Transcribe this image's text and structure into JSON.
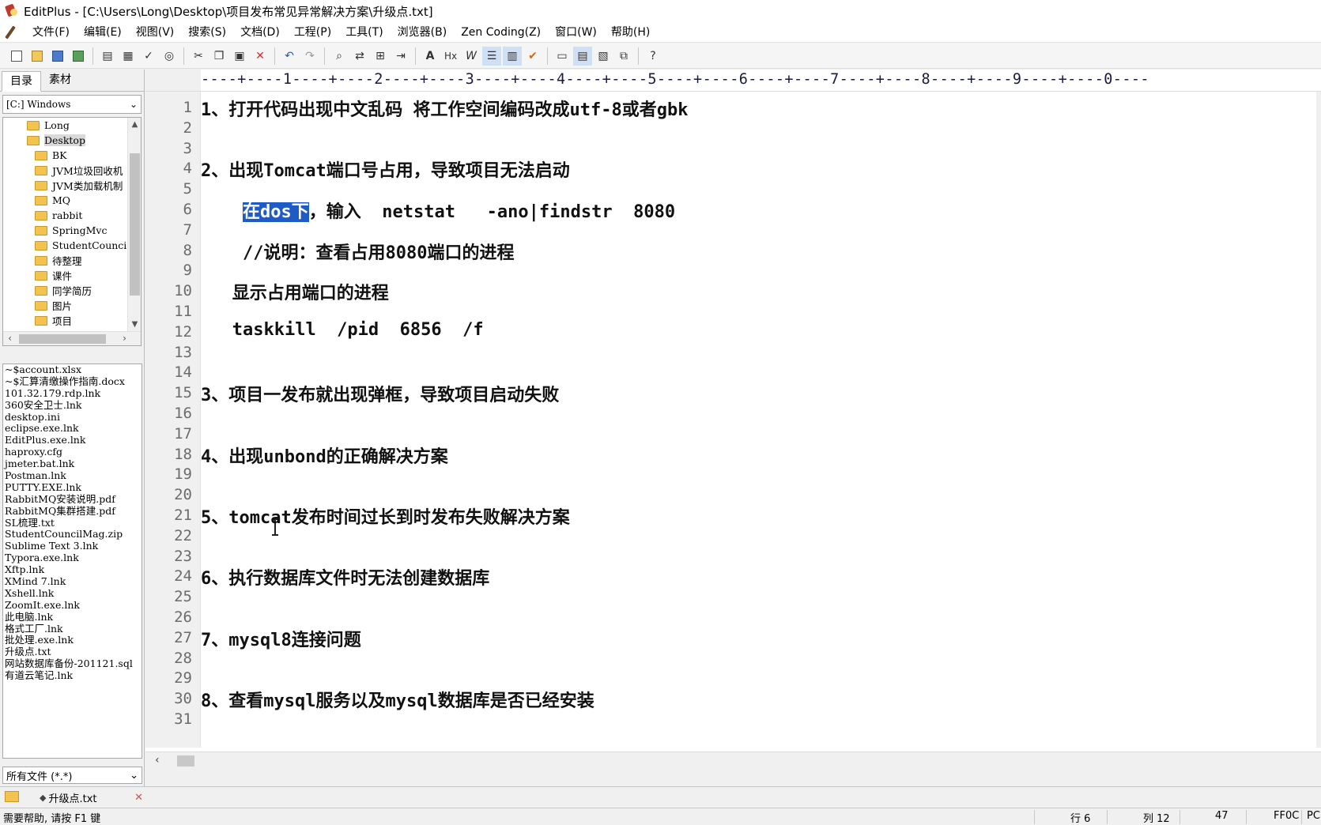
{
  "window": {
    "title": "EditPlus - [C:\\Users\\Long\\Desktop\\项目发布常见异常解决方案\\升级点.txt]"
  },
  "menu": [
    "文件(F)",
    "编辑(E)",
    "视图(V)",
    "搜索(S)",
    "文档(D)",
    "工程(P)",
    "工具(T)",
    "浏览器(B)",
    "Zen Coding(Z)",
    "窗口(W)",
    "帮助(H)"
  ],
  "toolbar": {
    "icons": [
      "new-file-icon",
      "open-file-icon",
      "save-icon",
      "save-all-icon",
      "print-preview-icon",
      "print-icon",
      "spell-check-icon",
      "browser-preview-icon",
      "cut-icon",
      "copy-icon",
      "paste-icon",
      "delete-icon",
      "undo-icon",
      "redo-icon",
      "find-icon",
      "replace-icon",
      "find-in-files-icon",
      "goto-line-icon",
      "font-icon",
      "hex-icon",
      "word-wrap-icon",
      "line-number-icon",
      "ruler-icon",
      "spell-check-auto-icon",
      "directory-window-icon",
      "output-window-icon",
      "clip-window-icon",
      "full-screen-icon",
      "help-icon"
    ]
  },
  "sidebar": {
    "tabs": [
      "目录",
      "素材"
    ],
    "drive": "[C:] Windows",
    "folders": [
      {
        "label": "Long",
        "level": 0,
        "selected": false
      },
      {
        "label": "Desktop",
        "level": 0,
        "selected": true
      },
      {
        "label": "BK",
        "level": 1,
        "selected": false
      },
      {
        "label": "JVM垃圾回收机",
        "level": 1,
        "selected": false
      },
      {
        "label": "JVM类加载机制",
        "level": 1,
        "selected": false
      },
      {
        "label": "MQ",
        "level": 1,
        "selected": false
      },
      {
        "label": "rabbit",
        "level": 1,
        "selected": false
      },
      {
        "label": "SpringMvc",
        "level": 1,
        "selected": false
      },
      {
        "label": "StudentCounci",
        "level": 1,
        "selected": false
      },
      {
        "label": "待整理",
        "level": 1,
        "selected": false
      },
      {
        "label": "课件",
        "level": 1,
        "selected": false
      },
      {
        "label": "同学简历",
        "level": 1,
        "selected": false
      },
      {
        "label": "图片",
        "level": 1,
        "selected": false
      },
      {
        "label": "项目",
        "level": 1,
        "selected": false
      }
    ],
    "files": [
      "~$account.xlsx",
      "~$汇算清缴操作指南.docx",
      "101.32.179.rdp.lnk",
      "360安全卫士.lnk",
      "desktop.ini",
      "eclipse.exe.lnk",
      "EditPlus.exe.lnk",
      "haproxy.cfg",
      "jmeter.bat.lnk",
      "Postman.lnk",
      "PUTTY.EXE.lnk",
      "RabbitMQ安装说明.pdf",
      "RabbitMQ集群搭建.pdf",
      "SL梳理.txt",
      "StudentCouncilMag.zip",
      "Sublime Text 3.lnk",
      "Typora.exe.lnk",
      "Xftp.lnk",
      "XMind 7.lnk",
      "Xshell.lnk",
      "ZoomIt.exe.lnk",
      "此电脑.lnk",
      "格式工厂.lnk",
      "批处理.exe.lnk",
      "升级点.txt",
      "网站数据库备份-201121.sql",
      "有道云笔记.lnk"
    ],
    "filter": "所有文件 (*.*)"
  },
  "editor": {
    "ruler": "----+----1----+----2----+----3----+----4----+----5----+----6----+----7----+----8----+----9----+----0----",
    "line_numbers": [
      "1",
      "2",
      "3",
      "4",
      "5",
      "6",
      "7",
      "8",
      "9",
      "10",
      "11",
      "12",
      "13",
      "14",
      "15",
      "16",
      "17",
      "18",
      "19",
      "20",
      "21",
      "22",
      "23",
      "24",
      "25",
      "26",
      "27",
      "28",
      "29",
      "30",
      "31"
    ],
    "lines": [
      {
        "text": "1、打开代码出现中文乱码 将工作空间编码改成utf-8或者gbk"
      },
      {
        "text": ""
      },
      {
        "text": ""
      },
      {
        "text": "2、出现Tomcat端口号占用，导致项目无法启动"
      },
      {
        "text": ""
      },
      {
        "text": "    ",
        "selected": "在dos下",
        "after": "，输入  netstat   -ano|findstr  8080"
      },
      {
        "text": ""
      },
      {
        "text": "    //说明：查看占用8080端口的进程"
      },
      {
        "text": ""
      },
      {
        "text": "   显示占用端口的进程"
      },
      {
        "text": ""
      },
      {
        "text": "   taskkill  /pid  6856  /f"
      },
      {
        "text": ""
      },
      {
        "text": ""
      },
      {
        "text": "3、项目一发布就出现弹框，导致项目启动失败"
      },
      {
        "text": ""
      },
      {
        "text": ""
      },
      {
        "text": "4、出现unbond的正确解决方案"
      },
      {
        "text": ""
      },
      {
        "text": ""
      },
      {
        "text": "5、tomcat发布时间过长到时发布失败解决方案"
      },
      {
        "text": ""
      },
      {
        "text": ""
      },
      {
        "text": "6、执行数据库文件时无法创建数据库"
      },
      {
        "text": ""
      },
      {
        "text": ""
      },
      {
        "text": "7、mysql8连接问题"
      },
      {
        "text": ""
      },
      {
        "text": ""
      },
      {
        "text": "8、查看mysql服务以及mysql数据库是否已经安装"
      },
      {
        "text": ""
      }
    ]
  },
  "doc_tabs": [
    {
      "label": "升级点.txt",
      "active": true
    }
  ],
  "status": {
    "help": "需要帮助, 请按 F1 键",
    "row": "行 6",
    "col": "列 12",
    "count": "47",
    "code": "FF0C",
    "more": "PC"
  }
}
